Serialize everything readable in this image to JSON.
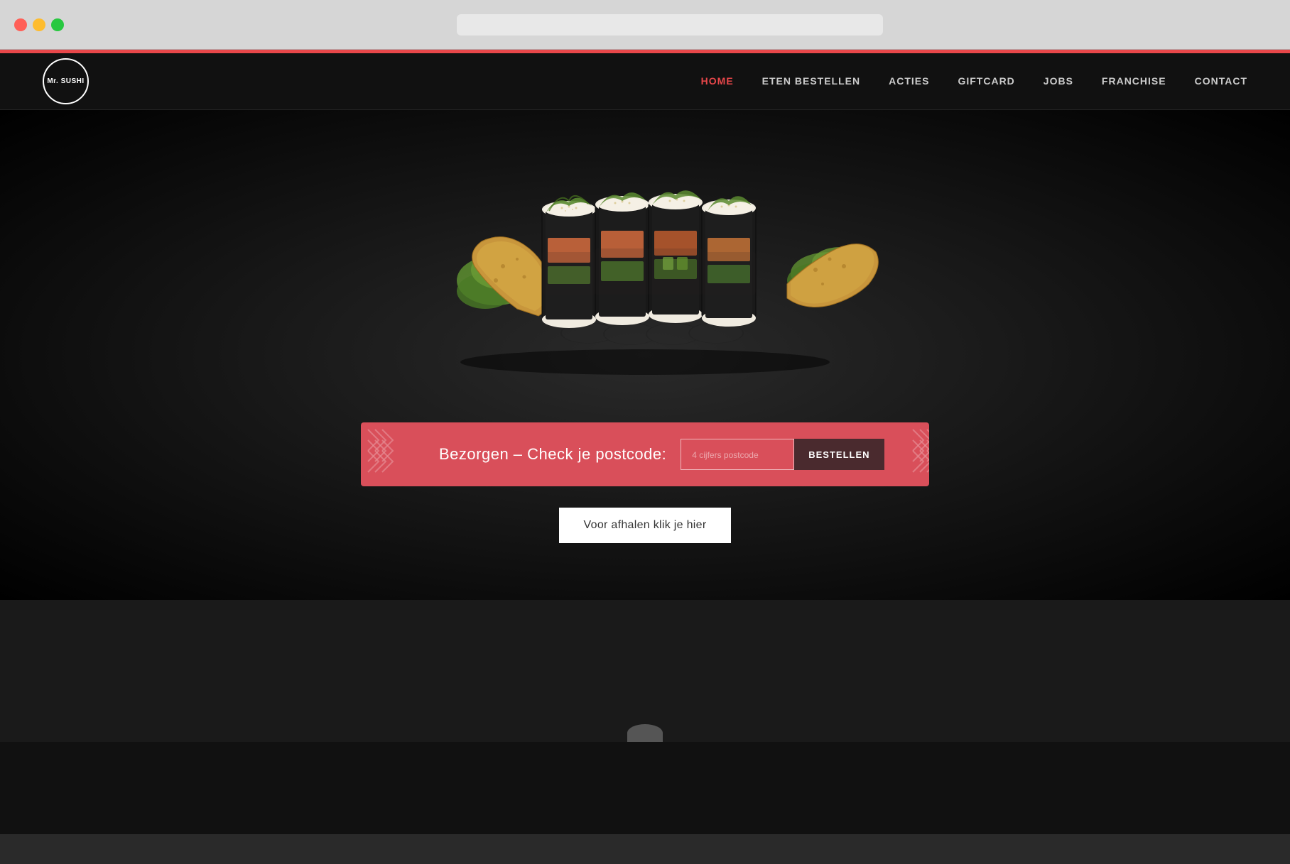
{
  "browser": {
    "traffic_lights": [
      "red",
      "yellow",
      "green"
    ]
  },
  "accent_line": {
    "color": "#e8474a"
  },
  "navbar": {
    "logo_text": "Mr. SUSHI",
    "links": [
      {
        "label": "HOME",
        "active": true
      },
      {
        "label": "ETEN BESTELLEN",
        "active": false
      },
      {
        "label": "ACTIES",
        "active": false
      },
      {
        "label": "GIFTCARD",
        "active": false
      },
      {
        "label": "JOBS",
        "active": false
      },
      {
        "label": "FRANCHISE",
        "active": false
      },
      {
        "label": "CONTACT",
        "active": false
      }
    ]
  },
  "delivery_banner": {
    "text": "Bezorgen –  Check je postcode:",
    "input_placeholder": "4 cijfers postcode",
    "button_label": "BESTELLEN"
  },
  "pickup": {
    "button_label": "Voor afhalen klik je hier"
  }
}
